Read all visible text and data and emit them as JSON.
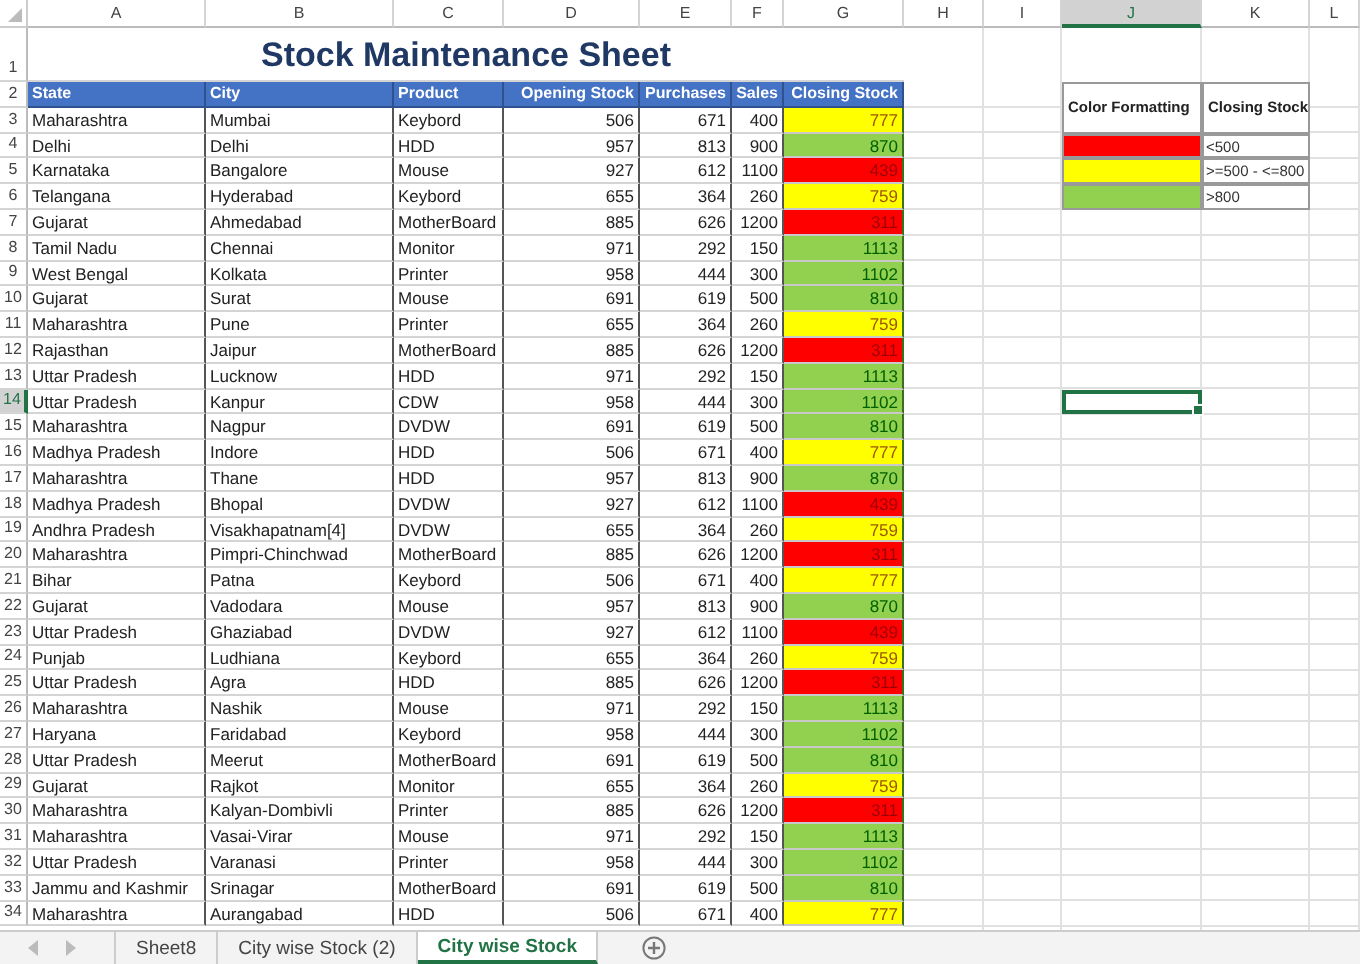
{
  "columns": [
    {
      "label": "A",
      "selected": false
    },
    {
      "label": "B",
      "selected": false
    },
    {
      "label": "C",
      "selected": false
    },
    {
      "label": "D",
      "selected": false
    },
    {
      "label": "E",
      "selected": false
    },
    {
      "label": "F",
      "selected": false
    },
    {
      "label": "G",
      "selected": false
    },
    {
      "label": "H",
      "selected": false
    },
    {
      "label": "I",
      "selected": false
    },
    {
      "label": "J",
      "selected": true
    },
    {
      "label": "K",
      "selected": false
    },
    {
      "label": "L",
      "selected": false
    }
  ],
  "title": {
    "row_number": "1",
    "text": "Stock Maintenance Sheet"
  },
  "header": {
    "row_number": "2",
    "cells": [
      "State",
      "City",
      "Product",
      "Opening Stock",
      "Purchases",
      "Sales",
      "Closing Stock"
    ]
  },
  "rows": [
    {
      "row_number": "3",
      "selected": false,
      "cells": [
        "Maharashtra",
        "Mumbai",
        "Keybord",
        "506",
        "671",
        "400",
        "777"
      ],
      "color": "#ffff00"
    },
    {
      "row_number": "4",
      "selected": false,
      "cells": [
        "Delhi",
        "Delhi",
        "HDD",
        "957",
        "813",
        "900",
        "870"
      ],
      "color": "#92d050"
    },
    {
      "row_number": "5",
      "selected": false,
      "cells": [
        "Karnataka",
        "Bangalore",
        "Mouse",
        "927",
        "612",
        "1100",
        "439"
      ],
      "color": "#ff0000"
    },
    {
      "row_number": "6",
      "selected": false,
      "cells": [
        "Telangana",
        "Hyderabad",
        "Keybord",
        "655",
        "364",
        "260",
        "759"
      ],
      "color": "#ffff00"
    },
    {
      "row_number": "7",
      "selected": false,
      "cells": [
        "Gujarat",
        "Ahmedabad",
        "MotherBoard",
        "885",
        "626",
        "1200",
        "311"
      ],
      "color": "#ff0000"
    },
    {
      "row_number": "8",
      "selected": false,
      "cells": [
        "Tamil Nadu",
        "Chennai",
        "Monitor",
        "971",
        "292",
        "150",
        "1113"
      ],
      "color": "#92d050"
    },
    {
      "row_number": "9",
      "selected": false,
      "cells": [
        "West Bengal",
        "Kolkata",
        "Printer",
        "958",
        "444",
        "300",
        "1102"
      ],
      "color": "#92d050"
    },
    {
      "row_number": "10",
      "selected": false,
      "cells": [
        "Gujarat",
        "Surat",
        "Mouse",
        "691",
        "619",
        "500",
        "810"
      ],
      "color": "#92d050"
    },
    {
      "row_number": "11",
      "selected": false,
      "cells": [
        "Maharashtra",
        "Pune",
        "Printer",
        "655",
        "364",
        "260",
        "759"
      ],
      "color": "#ffff00"
    },
    {
      "row_number": "12",
      "selected": false,
      "cells": [
        "Rajasthan",
        "Jaipur",
        "MotherBoard",
        "885",
        "626",
        "1200",
        "311"
      ],
      "color": "#ff0000"
    },
    {
      "row_number": "13",
      "selected": false,
      "cells": [
        "Uttar Pradesh",
        "Lucknow",
        "HDD",
        "971",
        "292",
        "150",
        "1113"
      ],
      "color": "#92d050"
    },
    {
      "row_number": "14",
      "selected": true,
      "cells": [
        "Uttar Pradesh",
        "Kanpur",
        "CDW",
        "958",
        "444",
        "300",
        "1102"
      ],
      "color": "#92d050"
    },
    {
      "row_number": "15",
      "selected": false,
      "cells": [
        "Maharashtra",
        "Nagpur",
        "DVDW",
        "691",
        "619",
        "500",
        "810"
      ],
      "color": "#92d050"
    },
    {
      "row_number": "16",
      "selected": false,
      "cells": [
        "Madhya Pradesh",
        "Indore",
        "HDD",
        "506",
        "671",
        "400",
        "777"
      ],
      "color": "#ffff00"
    },
    {
      "row_number": "17",
      "selected": false,
      "cells": [
        "Maharashtra",
        "Thane",
        "HDD",
        "957",
        "813",
        "900",
        "870"
      ],
      "color": "#92d050"
    },
    {
      "row_number": "18",
      "selected": false,
      "cells": [
        "Madhya Pradesh",
        "Bhopal",
        "DVDW",
        "927",
        "612",
        "1100",
        "439"
      ],
      "color": "#ff0000"
    },
    {
      "row_number": "19",
      "selected": false,
      "cells": [
        "Andhra Pradesh",
        "Visakhapatnam[4]",
        "DVDW",
        "655",
        "364",
        "260",
        "759"
      ],
      "color": "#ffff00"
    },
    {
      "row_number": "20",
      "selected": false,
      "cells": [
        "Maharashtra",
        "Pimpri-Chinchwad",
        "MotherBoard",
        "885",
        "626",
        "1200",
        "311"
      ],
      "color": "#ff0000"
    },
    {
      "row_number": "21",
      "selected": false,
      "cells": [
        "Bihar",
        "Patna",
        "Keybord",
        "506",
        "671",
        "400",
        "777"
      ],
      "color": "#ffff00"
    },
    {
      "row_number": "22",
      "selected": false,
      "cells": [
        "Gujarat",
        "Vadodara",
        "Mouse",
        "957",
        "813",
        "900",
        "870"
      ],
      "color": "#92d050"
    },
    {
      "row_number": "23",
      "selected": false,
      "cells": [
        "Uttar Pradesh",
        "Ghaziabad",
        "DVDW",
        "927",
        "612",
        "1100",
        "439"
      ],
      "color": "#ff0000"
    },
    {
      "row_number": "24",
      "selected": false,
      "cells": [
        "Punjab",
        "Ludhiana",
        "Keybord",
        "655",
        "364",
        "260",
        "759"
      ],
      "color": "#ffff00"
    },
    {
      "row_number": "25",
      "selected": false,
      "cells": [
        "Uttar Pradesh",
        "Agra",
        "HDD",
        "885",
        "626",
        "1200",
        "311"
      ],
      "color": "#ff0000"
    },
    {
      "row_number": "26",
      "selected": false,
      "cells": [
        "Maharashtra",
        "Nashik",
        "Mouse",
        "971",
        "292",
        "150",
        "1113"
      ],
      "color": "#92d050"
    },
    {
      "row_number": "27",
      "selected": false,
      "cells": [
        "Haryana",
        "Faridabad",
        "Keybord",
        "958",
        "444",
        "300",
        "1102"
      ],
      "color": "#92d050"
    },
    {
      "row_number": "28",
      "selected": false,
      "cells": [
        "Uttar Pradesh",
        "Meerut",
        "MotherBoard",
        "691",
        "619",
        "500",
        "810"
      ],
      "color": "#92d050"
    },
    {
      "row_number": "29",
      "selected": false,
      "cells": [
        "Gujarat",
        "Rajkot",
        "Monitor",
        "655",
        "364",
        "260",
        "759"
      ],
      "color": "#ffff00"
    },
    {
      "row_number": "30",
      "selected": false,
      "cells": [
        "Maharashtra",
        "Kalyan-Dombivli",
        "Printer",
        "885",
        "626",
        "1200",
        "311"
      ],
      "color": "#ff0000"
    },
    {
      "row_number": "31",
      "selected": false,
      "cells": [
        "Maharashtra",
        "Vasai-Virar",
        "Mouse",
        "971",
        "292",
        "150",
        "1113"
      ],
      "color": "#92d050"
    },
    {
      "row_number": "32",
      "selected": false,
      "cells": [
        "Uttar Pradesh",
        "Varanasi",
        "Printer",
        "958",
        "444",
        "300",
        "1102"
      ],
      "color": "#92d050"
    },
    {
      "row_number": "33",
      "selected": false,
      "cells": [
        "Jammu and Kashmir",
        "Srinagar",
        "MotherBoard",
        "691",
        "619",
        "500",
        "810"
      ],
      "color": "#92d050"
    },
    {
      "row_number": "34",
      "selected": false,
      "cells": [
        "Maharashtra",
        "Aurangabad",
        "HDD",
        "506",
        "671",
        "400",
        "777"
      ],
      "color": "#ffff00"
    }
  ],
  "legend": {
    "header": [
      "Color Formatting",
      "Closing Stock"
    ],
    "rows": [
      {
        "color": "#ff0000",
        "text": "<500"
      },
      {
        "color": "#ffff00",
        "text": ">=500 - <=800"
      },
      {
        "color": "#92d050",
        "text": ">800"
      }
    ]
  },
  "sheet_tabs": [
    {
      "label": "Sheet8",
      "selected": false
    },
    {
      "label": "City wise Stock (2)",
      "selected": false
    },
    {
      "label": "City wise Stock",
      "selected": true
    }
  ]
}
